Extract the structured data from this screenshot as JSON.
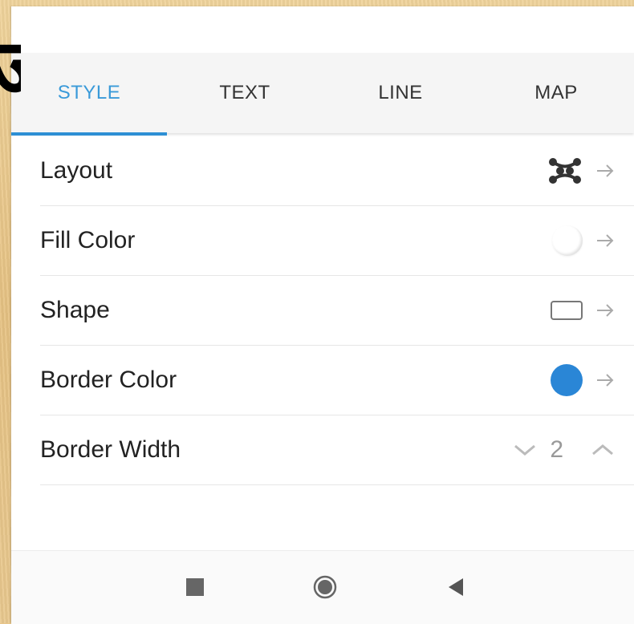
{
  "overlay": {
    "glyph": "ज"
  },
  "tabs": [
    {
      "label": "STYLE",
      "active": true
    },
    {
      "label": "TEXT",
      "active": false
    },
    {
      "label": "LINE",
      "active": false
    },
    {
      "label": "MAP",
      "active": false
    }
  ],
  "rows": {
    "layout": {
      "label": "Layout",
      "icon": "layout-network-icon"
    },
    "fill_color": {
      "label": "Fill Color",
      "value_color": "#ffffff"
    },
    "shape": {
      "label": "Shape",
      "icon": "rounded-rectangle-icon"
    },
    "border_color": {
      "label": "Border Color",
      "value_color": "#2a86d6"
    },
    "border_width": {
      "label": "Border Width",
      "value": "2"
    }
  },
  "navbar": {
    "icons": [
      "recents-square-icon",
      "home-circle-icon",
      "back-triangle-icon"
    ]
  },
  "colors": {
    "accent": "#2d8fd4",
    "accent_text": "#3a9ad9"
  }
}
